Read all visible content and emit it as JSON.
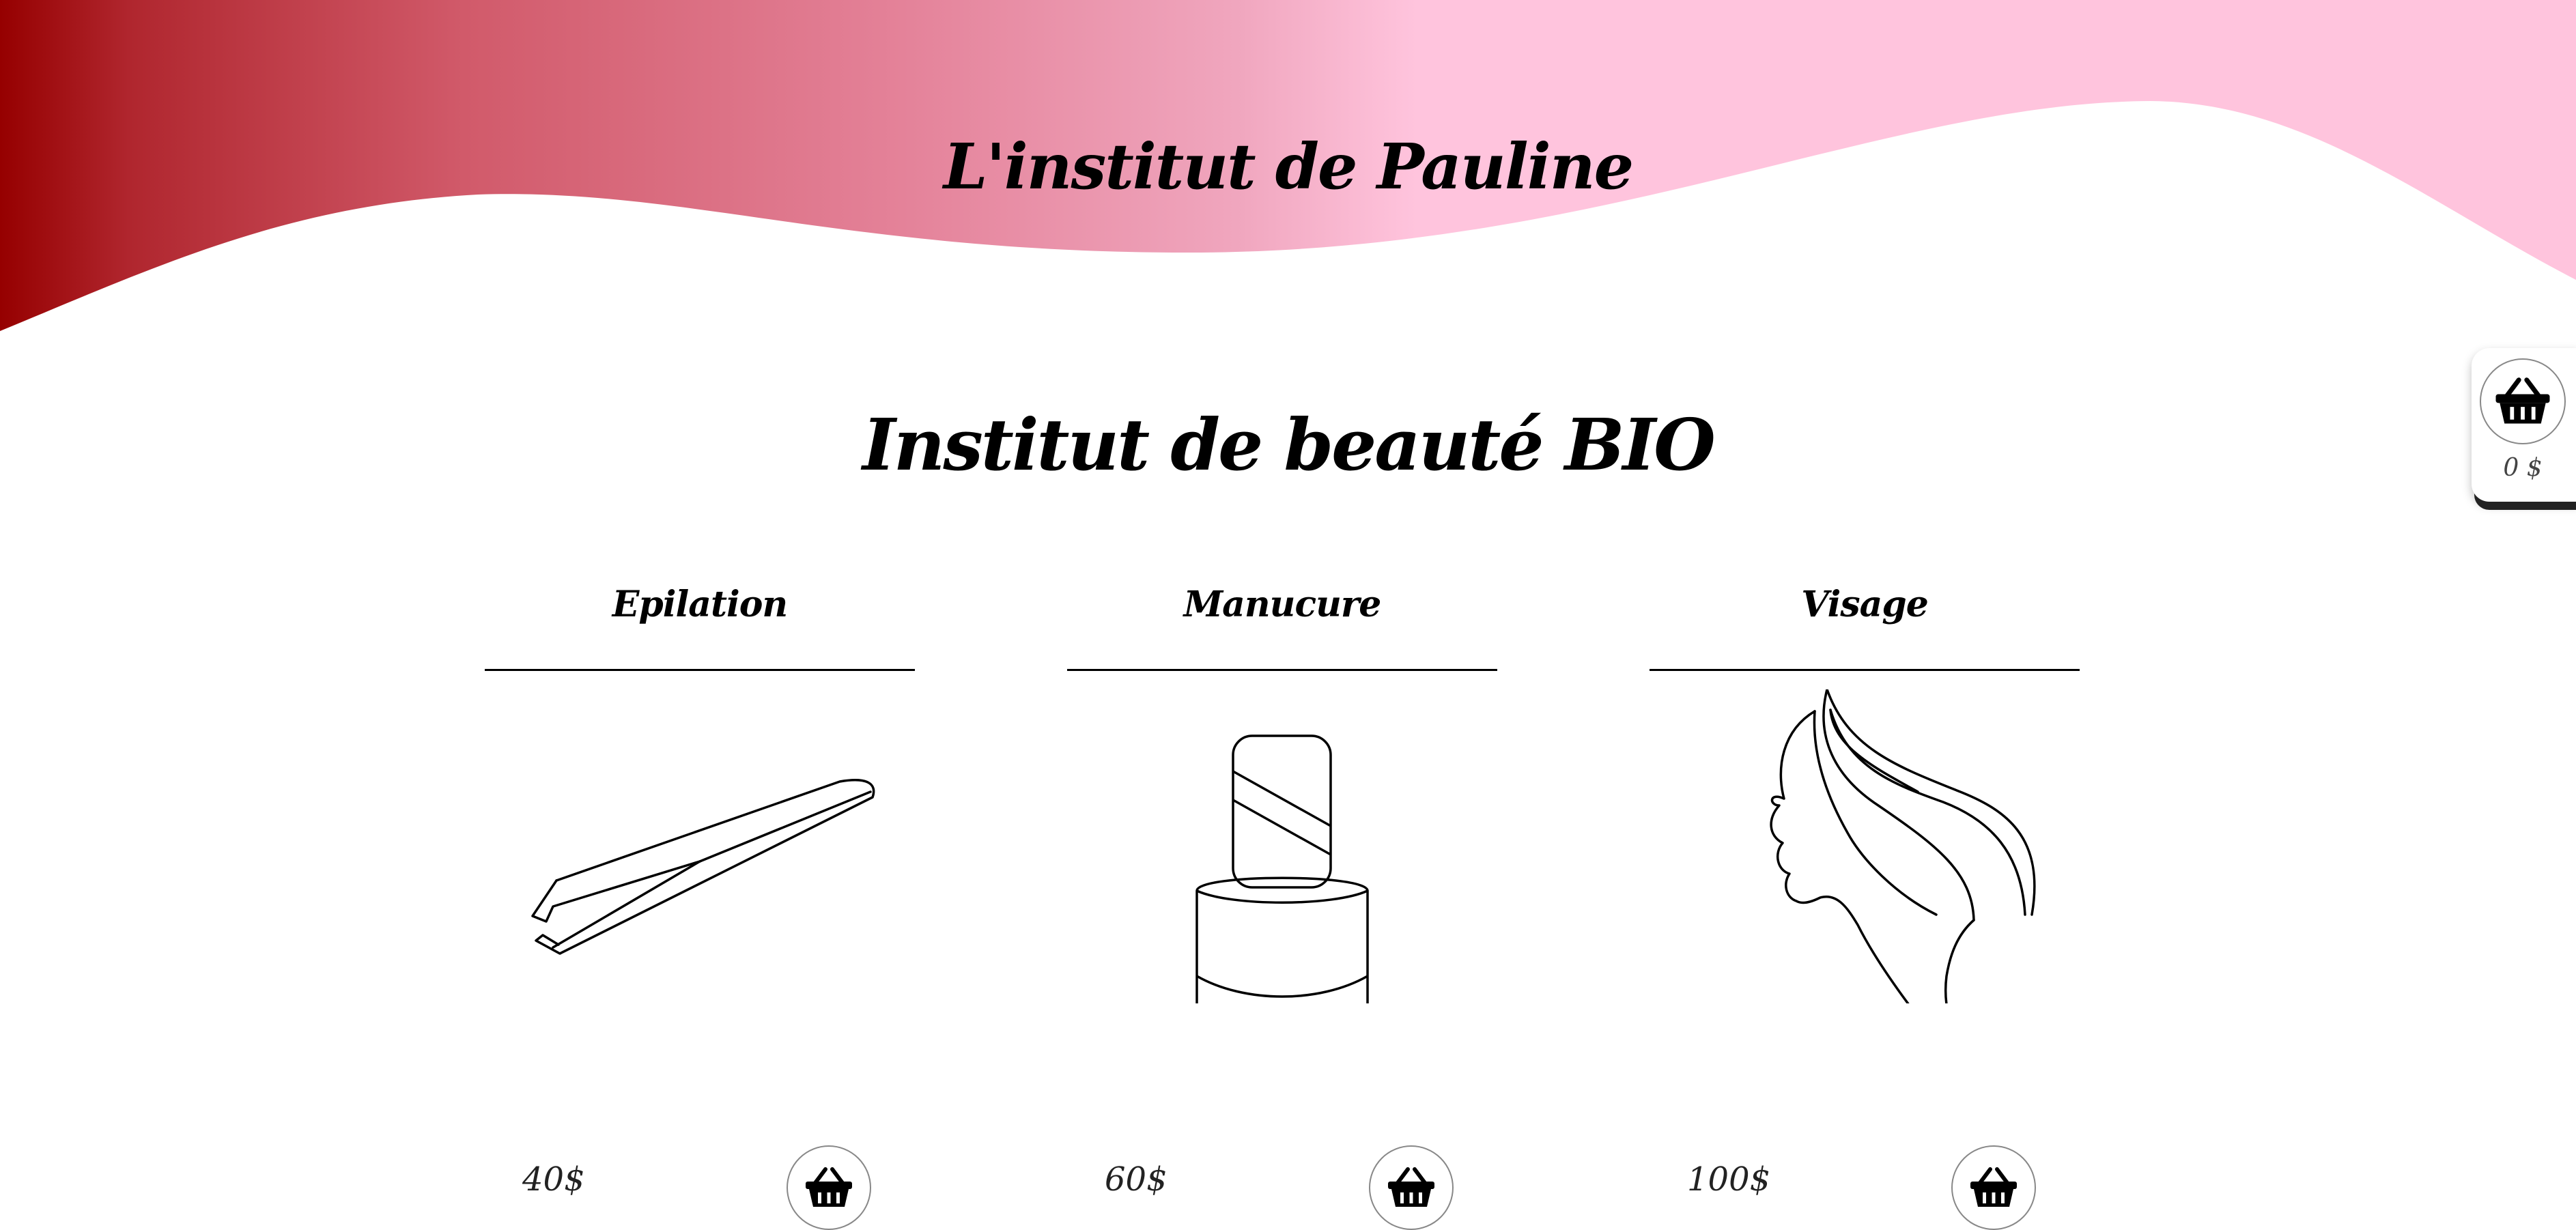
{
  "header": {
    "title": "L'institut de Pauline",
    "gradient": {
      "left": "#960000",
      "mid": "#e07f97",
      "right": "#ffc4dd"
    }
  },
  "main": {
    "heading": "Institut de beauté BIO"
  },
  "products": [
    {
      "name": "Epilation",
      "price": "40$",
      "illustration": "tweezers-icon"
    },
    {
      "name": "Manucure",
      "price": "60$",
      "illustration": "nail-polish-icon"
    },
    {
      "name": "Visage",
      "price": "100$",
      "illustration": "woman-face-profile-icon"
    }
  ],
  "cart": {
    "total": "0 $",
    "icon": "basket-icon"
  },
  "colors": {
    "line": "#000000",
    "background": "#ffffff"
  }
}
